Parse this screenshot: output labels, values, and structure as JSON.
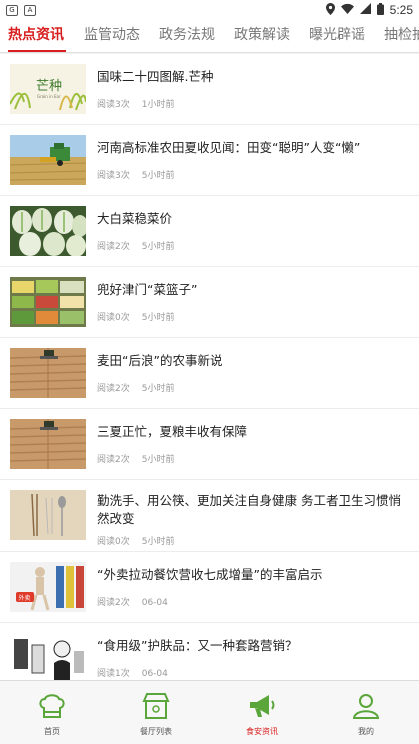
{
  "status_bar": {
    "time": "5:25",
    "left_icons": [
      "gboard-icon",
      "a-notification-icon"
    ],
    "right_icons": [
      "location-icon",
      "wifi-icon",
      "signal-icon",
      "battery-icon"
    ]
  },
  "tabs": [
    {
      "label": "热点资讯",
      "active": true
    },
    {
      "label": "监管动态",
      "active": false
    },
    {
      "label": "政务法规",
      "active": false
    },
    {
      "label": "政策解读",
      "active": false
    },
    {
      "label": "曝光辟谣",
      "active": false
    },
    {
      "label": "抽检抽查",
      "active": false
    }
  ],
  "thumb_texts": {
    "mangzhong_title": "芒种",
    "mangzhong_sub": "Grain in Ear",
    "takeaway_tag": "外卖"
  },
  "news": [
    {
      "title": "国味二十四图解.芒种",
      "reads": "阅读3次",
      "time": "1小时前",
      "thumb": "mangzhong-thumb"
    },
    {
      "title": "河南高标准农田夏收见闻：田变“聪明”人变“懒”",
      "reads": "阅读3次",
      "time": "5小时前",
      "thumb": "harvester-thumb"
    },
    {
      "title": "大白菜稳菜价",
      "reads": "阅读2次",
      "time": "5小时前",
      "thumb": "cabbage-thumb"
    },
    {
      "title": "兜好津门“菜篮子”",
      "reads": "阅读0次",
      "time": "5小时前",
      "thumb": "market-thumb"
    },
    {
      "title": "麦田“后浪”的农事新说",
      "reads": "阅读2次",
      "time": "5小时前",
      "thumb": "field-tractor-thumb"
    },
    {
      "title": "三夏正忙，夏粮丰收有保障",
      "reads": "阅读2次",
      "time": "5小时前",
      "thumb": "field-tractor-thumb-2"
    },
    {
      "title": "勤洗手、用公筷、更加关注自身健康 务工者卫生习惯悄然改变",
      "reads": "阅读0次",
      "time": "5小时前",
      "thumb": "chopsticks-thumb"
    },
    {
      "title": "“外卖拉动餐饮营收七成增量”的丰富启示",
      "reads": "阅读2次",
      "time": "06-04",
      "thumb": "takeaway-thumb"
    },
    {
      "title": "“食用级”护肤品：又一种套路营销？",
      "reads": "阅读1次",
      "time": "06-04",
      "thumb": "cosmetics-thumb"
    }
  ],
  "bottom_nav": [
    {
      "label": "首页",
      "icon": "chef-hat-icon",
      "active": false
    },
    {
      "label": "餐厅列表",
      "icon": "restaurant-icon",
      "active": false
    },
    {
      "label": "食安资讯",
      "icon": "megaphone-icon",
      "active": true
    },
    {
      "label": "我的",
      "icon": "user-icon",
      "active": false
    }
  ],
  "colors": {
    "accent": "#d81e1e",
    "icon_green": "#5aa63a",
    "text_main": "#222222",
    "text_meta": "#999999"
  }
}
